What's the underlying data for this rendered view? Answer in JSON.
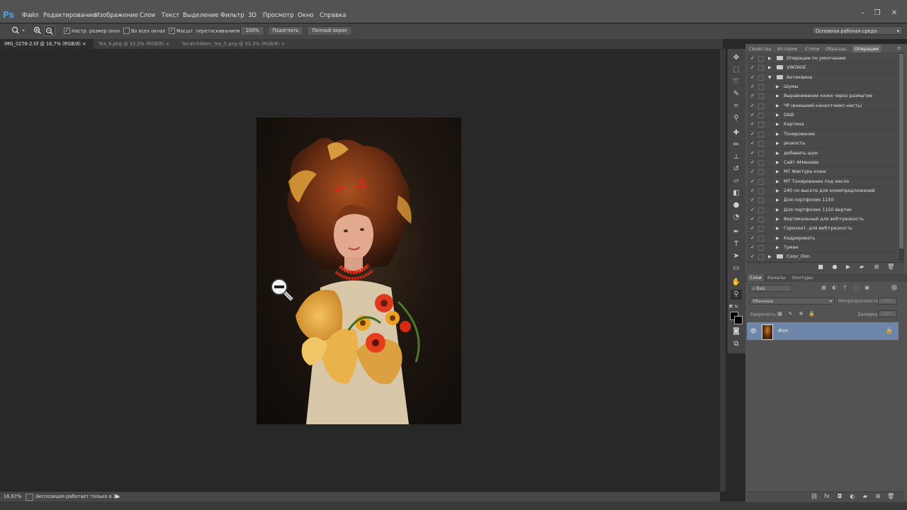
{
  "app": {
    "logo": "Ps"
  },
  "menu": [
    "Файл",
    "Редактирование",
    "Изображение",
    "Слои",
    "Текст",
    "Выделение",
    "Фильтр",
    "3D",
    "Просмотр",
    "Окно",
    "Справка"
  ],
  "window_controls": {
    "minimize": "–",
    "restore": "❐",
    "close": "✕"
  },
  "options": {
    "resize_windows": "Настр. размер окон",
    "all_windows": "Во всех окнах",
    "scrubby_zoom": "Масшт. перетаскиванием",
    "zoom_100": "100%",
    "fit_screen": "Подогнать",
    "fill_screen": "Полный экран",
    "workspace": "Основная рабочая среда"
  },
  "document_tabs": [
    {
      "label": "IMG_0276-2.tif @ 16,7% (RGB/8)",
      "close": "×"
    },
    {
      "label": "Tex_4.png @ 33,3% (RGB/8)",
      "close": "×"
    },
    {
      "label": "ScratchWorn_tex_5.png @ 33,3% (RGB/8)",
      "close": "×"
    }
  ],
  "status": {
    "zoom": "16,67%",
    "info": "Экспозиция работает только в 3..."
  },
  "panel_tabs": [
    "Свойства",
    "История",
    "Стили",
    "Образцы",
    "Операции"
  ],
  "actions": [
    {
      "label": "Операции по умолчанию",
      "level": 0,
      "folder": true,
      "open": false
    },
    {
      "label": "VINTAGE",
      "level": 0,
      "folder": true,
      "open": false
    },
    {
      "label": "Антиквина",
      "level": 0,
      "folder": true,
      "open": true
    },
    {
      "label": "Шумы",
      "level": 1
    },
    {
      "label": "Выравнивание кожи через размытие",
      "level": 1
    },
    {
      "label": "ЧР (внешний канал+микс-кисть)",
      "level": 1
    },
    {
      "label": "D&B",
      "level": 1
    },
    {
      "label": "Картина",
      "level": 1
    },
    {
      "label": "Тонирование",
      "level": 1
    },
    {
      "label": "резкость",
      "level": 1
    },
    {
      "label": "добавить шум",
      "level": 1
    },
    {
      "label": "Сайт АНишева",
      "level": 1
    },
    {
      "label": "МТ Фактура кожи",
      "level": 1
    },
    {
      "label": "МТ Тонирование под масло",
      "level": 1
    },
    {
      "label": "240 по высоте для коммпредложений",
      "level": 1
    },
    {
      "label": "Для портфолио 1150",
      "level": 1
    },
    {
      "label": "Для портфолио 1150 вертик",
      "level": 1
    },
    {
      "label": "Вертикальный для веб+резкость",
      "level": 1
    },
    {
      "label": "Горизонт. для веб+резкость",
      "level": 1
    },
    {
      "label": "Кадрировать",
      "level": 1
    },
    {
      "label": "Туман",
      "level": 1
    },
    {
      "label": "Color_Film",
      "level": 0,
      "folder": true,
      "open": false
    }
  ],
  "layers_tabs": [
    "Слои",
    "Каналы",
    "Контуры"
  ],
  "layers": {
    "filter": "Вид",
    "blend_mode": "Обычные",
    "opacity_label": "Непрозрачность:",
    "opacity_value": "100%",
    "lock_label": "Закрепить:",
    "fill_label": "Заливка:",
    "fill_value": "100%",
    "items": [
      {
        "name": "Фон",
        "visible_icon": "eye-icon",
        "locked": true
      }
    ]
  },
  "colors": {
    "accent": "#4aa3df",
    "selected_layer": "#6e87a9"
  }
}
